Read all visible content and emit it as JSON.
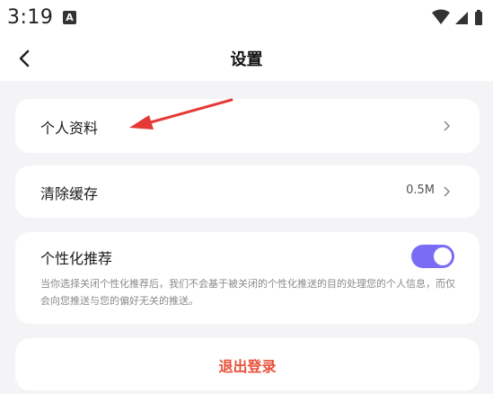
{
  "status_bar": {
    "time": "3:19",
    "notification_glyph": "A",
    "icons": [
      "wifi-icon",
      "signal-icon",
      "battery-icon"
    ]
  },
  "header": {
    "title": "设置",
    "back_icon": "back-arrow-icon"
  },
  "settings": {
    "profile": {
      "label": "个人资料"
    },
    "clear_cache": {
      "label": "清除缓存",
      "value": "0.5M"
    },
    "personalized": {
      "label": "个性化推荐",
      "enabled": true,
      "description": "当你选择关闭个性化推荐后，我们不会基于被关闭的个性化推送的目的处理您的个人信息，而仅会向您推送与您的偏好无关的推送。"
    }
  },
  "logout": {
    "label": "退出登录"
  },
  "colors": {
    "accent": "#7b6cf6",
    "logout": "#e8503a",
    "annotation_arrow": "#e53935"
  }
}
